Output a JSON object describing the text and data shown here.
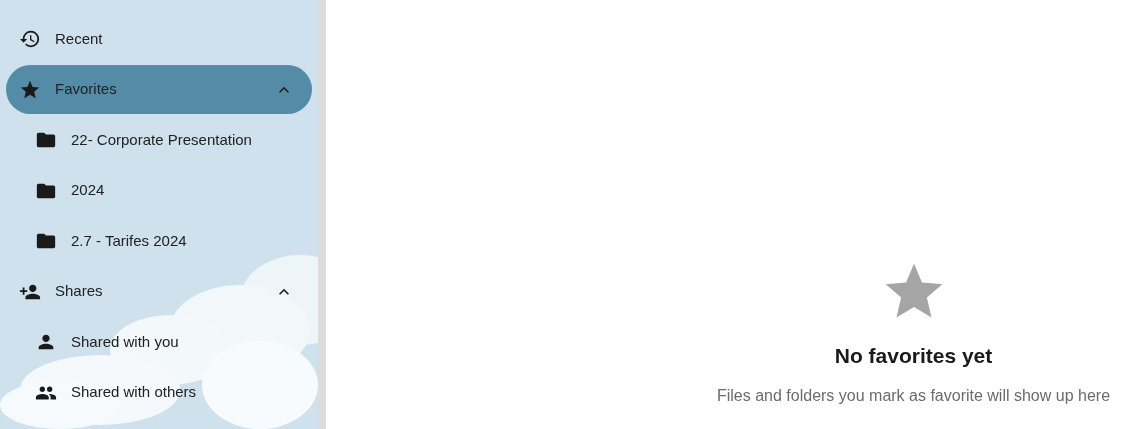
{
  "sidebar": {
    "items": [
      {
        "label": "Recent",
        "selected": false
      },
      {
        "label": "Favorites",
        "selected": true,
        "expanded": true,
        "children": [
          {
            "label": "22- Corporate Presentation",
            "selected": false
          },
          {
            "label": "2024",
            "selected": false
          },
          {
            "label": "2.7 - Tarifes 2024",
            "selected": false
          }
        ]
      },
      {
        "label": "Shares",
        "selected": false,
        "expanded": true,
        "children": [
          {
            "label": "Shared with you",
            "selected": false
          },
          {
            "label": "Shared with others",
            "selected": false
          }
        ]
      }
    ]
  },
  "empty_state": {
    "title": "No favorites yet",
    "message": "Files and folders you mark as favorite will show up here"
  }
}
